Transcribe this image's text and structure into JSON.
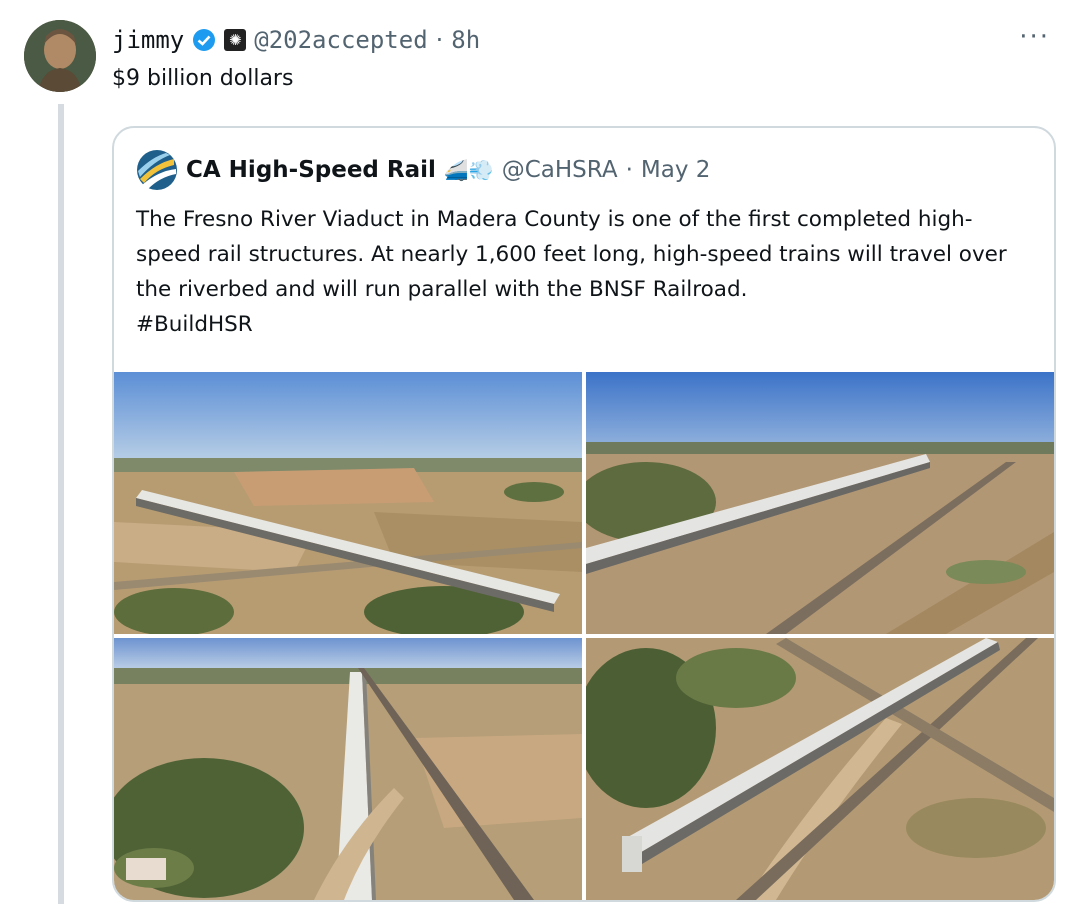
{
  "tweet": {
    "display_name": "jimmy",
    "affiliate_glyph": "✺",
    "handle": "@202accepted",
    "separator": "·",
    "time": "8h",
    "more_label": "···",
    "text": "$9 billion dollars"
  },
  "quoted": {
    "display_name": "CA High-Speed Rail",
    "emojis": "🚄💨",
    "handle": "@CaHSRA",
    "separator": "·",
    "date": "May 2",
    "text": "The Fresno River Viaduct in Madera County is one of the first completed high-speed rail structures. At nearly 1,600 feet long, high-speed trains will travel over the riverbed and will run parallel with the BNSF Railroad.",
    "hashtag": "#BuildHSR",
    "photos": [
      "aerial-viaduct-photo-1",
      "aerial-viaduct-photo-2",
      "aerial-viaduct-photo-3",
      "aerial-viaduct-photo-4"
    ]
  },
  "colors": {
    "verified_blue": "#1d9bf0",
    "secondary_text": "#536471",
    "border": "#cfd9de"
  }
}
